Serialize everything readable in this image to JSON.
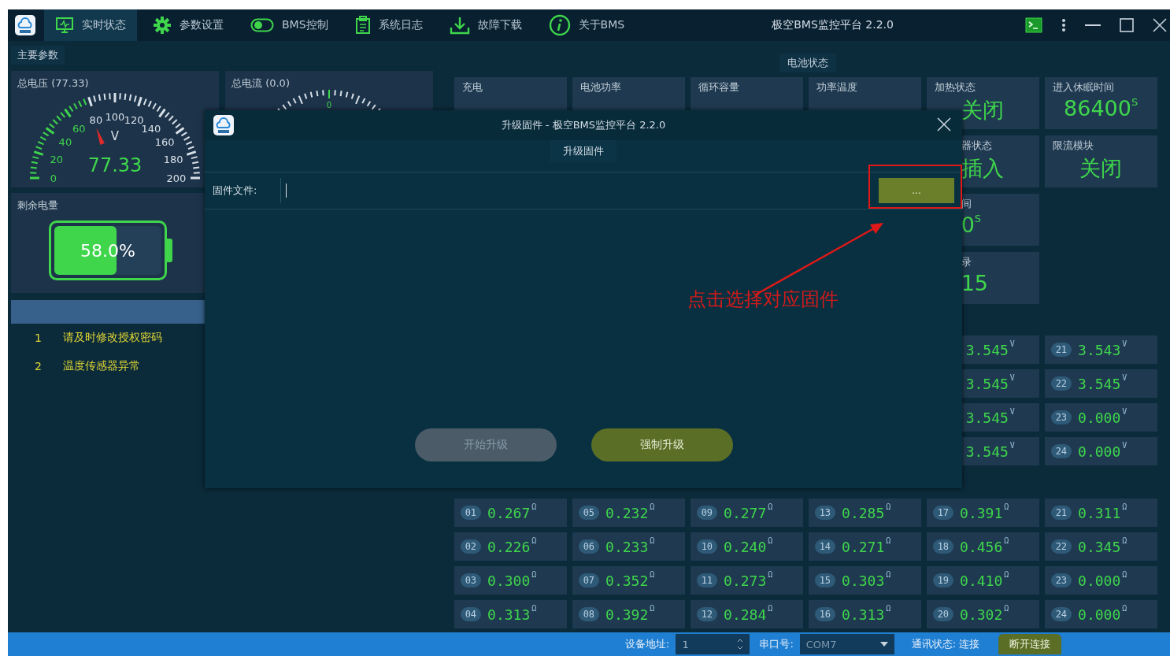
{
  "title_bar": {
    "title": "极空BMS监控平台 2.2.0"
  },
  "nav_tabs": [
    {
      "label": "实时状态",
      "kind": "monitor",
      "selected": true
    },
    {
      "label": "参数设置",
      "kind": "gear",
      "selected": false
    },
    {
      "label": "BMS控制",
      "kind": "toggle",
      "selected": false
    },
    {
      "label": "系统日志",
      "kind": "log",
      "selected": false
    },
    {
      "label": "故障下载",
      "kind": "download",
      "selected": false
    },
    {
      "label": "关于BMS",
      "kind": "info",
      "selected": false
    }
  ],
  "main_params": {
    "title": "主要参数",
    "voltage_gauge": {
      "title": "总电压 (77.33)",
      "value": "77.33",
      "unit": "V",
      "tick_labels": [
        "0",
        "20",
        "40",
        "60",
        "80",
        "100",
        "120",
        "140",
        "160",
        "180",
        "200"
      ],
      "level": 0.387
    },
    "current_gauge": {
      "title": "总电流 (0.0)",
      "tick_label": "0"
    },
    "battery": {
      "title": "剩余电量",
      "reading": "58.0%",
      "level": 0.58
    },
    "alarms": [
      {
        "number": "1",
        "message": "请及时修改授权密码"
      },
      {
        "number": "2",
        "message": "温度传感器异常"
      }
    ]
  },
  "battery_status": {
    "title": "电池状态",
    "card_rows": [
      [
        {
          "label": "充电"
        },
        {
          "label": "电池功率"
        },
        {
          "label": "循环容量"
        },
        {
          "label": "功率温度"
        },
        {
          "label": "加热状态",
          "value": "关闭"
        },
        {
          "label": "进入休眠时间",
          "value": "86400",
          "unit": "S"
        }
      ],
      [
        {
          "label": "器状态",
          "value": "插入"
        },
        {
          "label": "限流模块",
          "value": "关闭"
        }
      ],
      [
        {
          "label": "间",
          "value": "0",
          "unit": "S"
        }
      ],
      [
        {
          "label": "录",
          "value": "15"
        }
      ]
    ]
  },
  "cell_voltages": [
    [
      {
        "value": "3.545",
        "unit": "V"
      },
      {
        "number": "21",
        "value": "3.543",
        "unit": "V"
      }
    ],
    [
      {
        "value": "3.545",
        "unit": "V"
      },
      {
        "number": "22",
        "value": "3.545",
        "unit": "V"
      }
    ],
    [
      {
        "value": "3.545",
        "unit": "V"
      },
      {
        "number": "23",
        "value": "0.000",
        "unit": "V"
      }
    ],
    [
      {
        "value": "3.545",
        "unit": "V"
      },
      {
        "number": "24",
        "value": "0.000",
        "unit": "V"
      }
    ]
  ],
  "resistances": [
    {
      "number": "01",
      "value": "0.267",
      "unit": "Ω"
    },
    {
      "number": "02",
      "value": "0.226",
      "unit": "Ω"
    },
    {
      "number": "03",
      "value": "0.300",
      "unit": "Ω"
    },
    {
      "number": "04",
      "value": "0.313",
      "unit": "Ω"
    },
    {
      "number": "05",
      "value": "0.232",
      "unit": "Ω"
    },
    {
      "number": "06",
      "value": "0.233",
      "unit": "Ω"
    },
    {
      "number": "07",
      "value": "0.352",
      "unit": "Ω"
    },
    {
      "number": "08",
      "value": "0.392",
      "unit": "Ω"
    },
    {
      "number": "09",
      "value": "0.277",
      "unit": "Ω"
    },
    {
      "number": "10",
      "value": "0.240",
      "unit": "Ω"
    },
    {
      "number": "11",
      "value": "0.273",
      "unit": "Ω"
    },
    {
      "number": "12",
      "value": "0.284",
      "unit": "Ω"
    },
    {
      "number": "13",
      "value": "0.285",
      "unit": "Ω"
    },
    {
      "number": "14",
      "value": "0.271",
      "unit": "Ω"
    },
    {
      "number": "15",
      "value": "0.303",
      "unit": "Ω"
    },
    {
      "number": "16",
      "value": "0.313",
      "unit": "Ω"
    },
    {
      "number": "17",
      "value": "0.391",
      "unit": "Ω"
    },
    {
      "number": "18",
      "value": "0.456",
      "unit": "Ω"
    },
    {
      "number": "19",
      "value": "0.410",
      "unit": "Ω"
    },
    {
      "number": "20",
      "value": "0.302",
      "unit": "Ω"
    },
    {
      "number": "21",
      "value": "0.311",
      "unit": "Ω"
    },
    {
      "number": "22",
      "value": "0.345",
      "unit": "Ω"
    },
    {
      "number": "23",
      "value": "0.000",
      "unit": "Ω"
    },
    {
      "number": "24",
      "value": "0.000",
      "unit": "Ω"
    }
  ],
  "dialog": {
    "title": "升级固件 - 极空BMS监控平台 2.2.0",
    "tab": "升级固件",
    "file_label": "固件文件:",
    "browse_button": "...",
    "buttons": [
      {
        "label": "开始升级",
        "disabled": true
      },
      {
        "label": "强制升级",
        "disabled": false
      }
    ],
    "annotation": "点击选择对应固件"
  },
  "status_bar": {
    "address_label": "设备地址:",
    "address_value": "1",
    "port_label": "串口号:",
    "port_value": "COM7",
    "comm_status": "通讯状态: 连接",
    "disconnect_button": "断开连接"
  }
}
